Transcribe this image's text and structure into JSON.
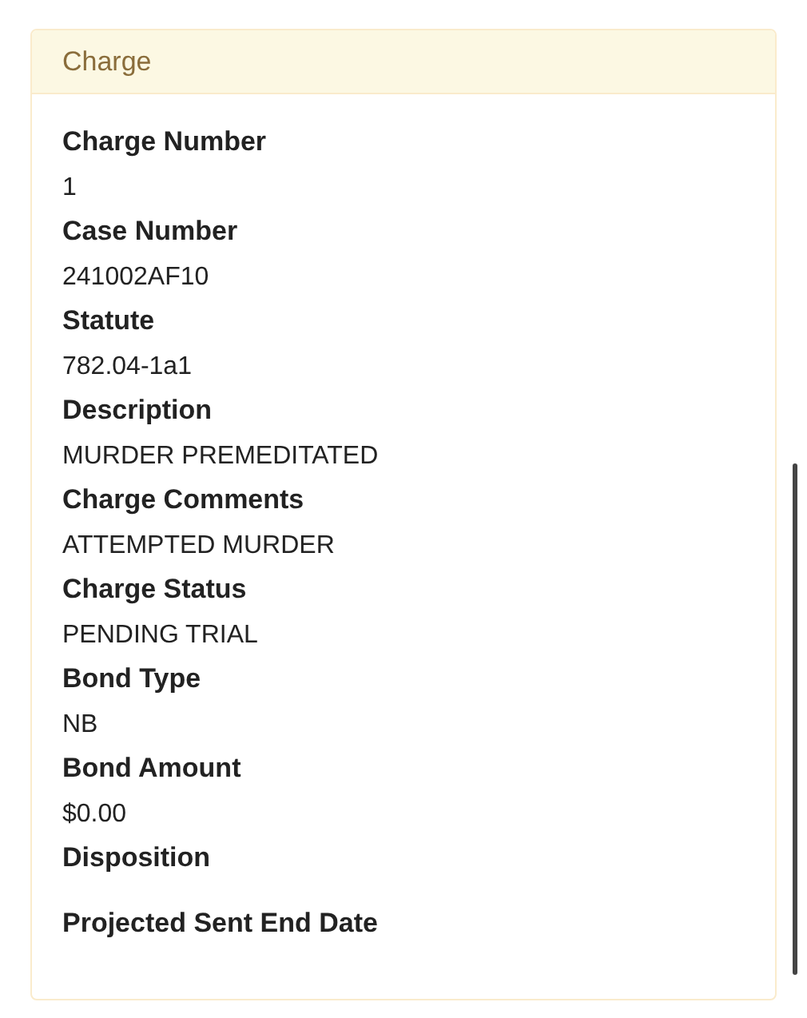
{
  "panel": {
    "title": "Charge"
  },
  "fields": [
    {
      "label": "Charge Number",
      "value": "1"
    },
    {
      "label": "Case Number",
      "value": "241002AF10"
    },
    {
      "label": "Statute",
      "value": "782.04-1a1"
    },
    {
      "label": "Description",
      "value": "MURDER PREMEDITATED"
    },
    {
      "label": "Charge Comments",
      "value": "ATTEMPTED MURDER"
    },
    {
      "label": "Charge Status",
      "value": "PENDING TRIAL"
    },
    {
      "label": "Bond Type",
      "value": "NB"
    },
    {
      "label": "Bond Amount",
      "value": "$0.00"
    },
    {
      "label": "Disposition"
    },
    {
      "label": "Projected Sent End Date"
    }
  ]
}
